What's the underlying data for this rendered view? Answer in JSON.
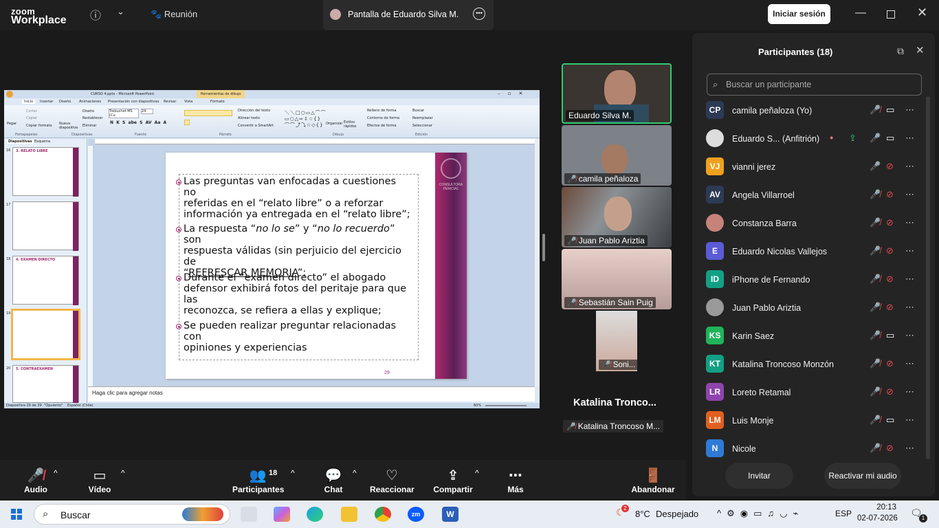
{
  "app": {
    "logo_line1": "zoom",
    "logo_line2": "Workplace",
    "meeting_label": "Reunión",
    "share_tab": "Pantalla de Eduardo Silva M.",
    "signin": "Iniciar sesión"
  },
  "ppt": {
    "title": "CURSO 4.pptx - Microsoft PowerPoint",
    "tools_tab": "Herramientas de dibujo",
    "tabs": [
      "Inicio",
      "Insertar",
      "Diseño",
      "Animaciones",
      "Presentación con diapositivas",
      "Revisar",
      "Vista",
      "Formato"
    ],
    "groups": [
      "Portapapeles",
      "Diapositivas",
      "Fuente",
      "Párrafo",
      "Dibujo",
      "Edición"
    ],
    "clip": [
      "Pegar",
      "Cortar",
      "Copiar",
      "Copiar formato"
    ],
    "slides_btns": [
      "Nueva diapositiva",
      "Diseño",
      "Restablecer",
      "Eliminar"
    ],
    "font": "Trebuchet MS (Cu",
    "size": "24",
    "para": [
      "Dirección del texto",
      "Alinear texto",
      "Convertir a SmartArt"
    ],
    "draw": [
      "Organizar",
      "Estilos rápidos",
      "Relleno de forma",
      "Contorno de forma",
      "Efectos de forma"
    ],
    "edit": [
      "Buscar",
      "Reemplazar",
      "Seleccionar"
    ],
    "panel_tabs": [
      "Diapositivas",
      "Esquema"
    ],
    "thumb_nums": [
      "16",
      "17",
      "18",
      "19",
      "20"
    ],
    "thumb_titles": [
      "3. RELATO LIBRE",
      "4. EXAMEN DIRECTO",
      "5. CONTRAEXAMEN"
    ],
    "notes": "Haga clic para agregar notas",
    "status": [
      "Diapositiva 29 de 39",
      "\"Opulento\"",
      "Español (Chile)"
    ],
    "zoom": "60%",
    "slide_side": "CONSULTORA PERICIAL",
    "slide_num": "29",
    "bullets": [
      {
        "lines": [
          "Las preguntas van enfocadas a cuestiones no",
          "referidas en el “relato libre” o a reforzar",
          "información ya entregada en el “relato libre”;"
        ]
      },
      {
        "l1a": "La respuesta “",
        "l1b": "no lo se",
        "l1c": "” y “",
        "l1d": "no lo recuerdo",
        "l1e": "” son",
        "l2": "respuesta válidas (sin perjuicio del ejercicio de",
        "l3a": "“",
        "l3b": "REFRESCAR MEMORIA",
        "l3c": "”;"
      },
      {
        "lines": [
          "Durante el “examen directo” el abogado",
          "defensor exhibirá fotos del peritaje para que las",
          "reconozca, se refiera a ellas y explique;"
        ]
      },
      {
        "lines": [
          "Se pueden realizar preguntar relacionadas con",
          "opiniones y experiencias"
        ]
      }
    ]
  },
  "videos": [
    {
      "name": "Eduardo Silva M.",
      "muted": false,
      "bg": "#3a3530"
    },
    {
      "name": "camila peñaloza",
      "muted": true,
      "bg": "#7d8188"
    },
    {
      "name": "Juan Pablo Ariztia",
      "muted": true,
      "bg": "#555a5f"
    },
    {
      "name": "Sebastián Sain Puig",
      "muted": true,
      "bg": "#d9bcb6"
    }
  ],
  "small_video": {
    "name": "Soni..."
  },
  "active_speaker": {
    "big": "Katalina  Tronco...",
    "label": "Katalina Troncoso M..."
  },
  "panel": {
    "title": "Participantes (18)",
    "search_placeholder": "Buscar un participante",
    "invite": "Invitar",
    "reactivate": "Reactivar mi audio",
    "people": [
      {
        "init": "CP",
        "name": "camila peñaloza (Yo)",
        "color": "#2d3a55",
        "mic": "off",
        "cam": "on"
      },
      {
        "init": "",
        "name": "Eduardo S... (Anfitrión)",
        "color": "#ddd",
        "mic": "on",
        "cam": "on",
        "host": true
      },
      {
        "init": "VJ",
        "name": "vianni jerez",
        "color": "#f0a020",
        "mic": "on",
        "cam": "off"
      },
      {
        "init": "AV",
        "name": "Angela Villarroel",
        "color": "#2d3a55",
        "mic": "off",
        "cam": "off"
      },
      {
        "init": "",
        "name": "Constanza Barra",
        "color": "#c7837a",
        "mic": "off",
        "cam": "off"
      },
      {
        "init": "E",
        "name": "Eduardo Nicolas Vallejos",
        "color": "#5b5bd6",
        "mic": "off",
        "cam": "off"
      },
      {
        "init": "ID",
        "name": "iPhone de Fernando",
        "color": "#12a085",
        "mic": "off",
        "cam": "off"
      },
      {
        "init": "",
        "name": "Juan Pablo Ariztia",
        "color": "#9a9a9a",
        "mic": "off",
        "cam": "off"
      },
      {
        "init": "KS",
        "name": "Karin Saez",
        "color": "#1fb35a",
        "mic": "off",
        "cam": "on"
      },
      {
        "init": "KT",
        "name": "Katalina Troncoso Monzón",
        "color": "#12a085",
        "mic": "off",
        "cam": "off"
      },
      {
        "init": "LR",
        "name": "Loreto Retamal",
        "color": "#8e44ad",
        "mic": "off",
        "cam": "off"
      },
      {
        "init": "LM",
        "name": "Luis Monje",
        "color": "#e06020",
        "mic": "off",
        "cam": "on"
      },
      {
        "init": "N",
        "name": "Nicole",
        "color": "#2f7ad6",
        "mic": "off",
        "cam": "off"
      }
    ]
  },
  "toolbar": {
    "audio": "Audio",
    "video": "Vídeo",
    "participants": "Participantes",
    "count": "18",
    "chat": "Chat",
    "react": "Reaccionar",
    "share": "Compartir",
    "more": "Más",
    "leave": "Abandonar"
  },
  "taskbar": {
    "search": "Buscar",
    "weather_temp": "8°C",
    "weather": "Despejado",
    "weather_badge": "2",
    "lang": "ESP",
    "time": "20:13",
    "date": "02-07-2026",
    "notif": "1"
  }
}
